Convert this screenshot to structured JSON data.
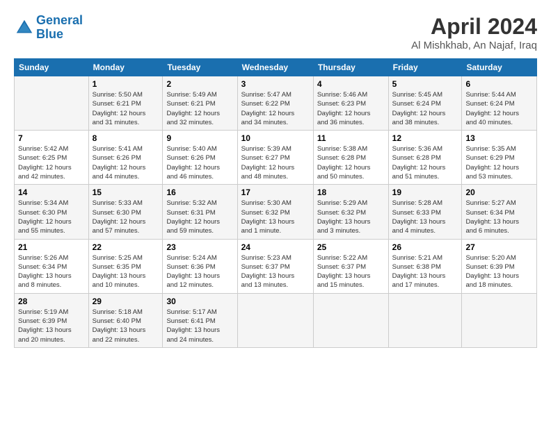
{
  "header": {
    "logo_line1": "General",
    "logo_line2": "Blue",
    "month_title": "April 2024",
    "location": "Al Mishkhab, An Najaf, Iraq"
  },
  "days_of_week": [
    "Sunday",
    "Monday",
    "Tuesday",
    "Wednesday",
    "Thursday",
    "Friday",
    "Saturday"
  ],
  "weeks": [
    [
      {
        "num": "",
        "info": ""
      },
      {
        "num": "1",
        "info": "Sunrise: 5:50 AM\nSunset: 6:21 PM\nDaylight: 12 hours\nand 31 minutes."
      },
      {
        "num": "2",
        "info": "Sunrise: 5:49 AM\nSunset: 6:21 PM\nDaylight: 12 hours\nand 32 minutes."
      },
      {
        "num": "3",
        "info": "Sunrise: 5:47 AM\nSunset: 6:22 PM\nDaylight: 12 hours\nand 34 minutes."
      },
      {
        "num": "4",
        "info": "Sunrise: 5:46 AM\nSunset: 6:23 PM\nDaylight: 12 hours\nand 36 minutes."
      },
      {
        "num": "5",
        "info": "Sunrise: 5:45 AM\nSunset: 6:24 PM\nDaylight: 12 hours\nand 38 minutes."
      },
      {
        "num": "6",
        "info": "Sunrise: 5:44 AM\nSunset: 6:24 PM\nDaylight: 12 hours\nand 40 minutes."
      }
    ],
    [
      {
        "num": "7",
        "info": "Sunrise: 5:42 AM\nSunset: 6:25 PM\nDaylight: 12 hours\nand 42 minutes."
      },
      {
        "num": "8",
        "info": "Sunrise: 5:41 AM\nSunset: 6:26 PM\nDaylight: 12 hours\nand 44 minutes."
      },
      {
        "num": "9",
        "info": "Sunrise: 5:40 AM\nSunset: 6:26 PM\nDaylight: 12 hours\nand 46 minutes."
      },
      {
        "num": "10",
        "info": "Sunrise: 5:39 AM\nSunset: 6:27 PM\nDaylight: 12 hours\nand 48 minutes."
      },
      {
        "num": "11",
        "info": "Sunrise: 5:38 AM\nSunset: 6:28 PM\nDaylight: 12 hours\nand 50 minutes."
      },
      {
        "num": "12",
        "info": "Sunrise: 5:36 AM\nSunset: 6:28 PM\nDaylight: 12 hours\nand 51 minutes."
      },
      {
        "num": "13",
        "info": "Sunrise: 5:35 AM\nSunset: 6:29 PM\nDaylight: 12 hours\nand 53 minutes."
      }
    ],
    [
      {
        "num": "14",
        "info": "Sunrise: 5:34 AM\nSunset: 6:30 PM\nDaylight: 12 hours\nand 55 minutes."
      },
      {
        "num": "15",
        "info": "Sunrise: 5:33 AM\nSunset: 6:30 PM\nDaylight: 12 hours\nand 57 minutes."
      },
      {
        "num": "16",
        "info": "Sunrise: 5:32 AM\nSunset: 6:31 PM\nDaylight: 12 hours\nand 59 minutes."
      },
      {
        "num": "17",
        "info": "Sunrise: 5:30 AM\nSunset: 6:32 PM\nDaylight: 13 hours\nand 1 minute."
      },
      {
        "num": "18",
        "info": "Sunrise: 5:29 AM\nSunset: 6:32 PM\nDaylight: 13 hours\nand 3 minutes."
      },
      {
        "num": "19",
        "info": "Sunrise: 5:28 AM\nSunset: 6:33 PM\nDaylight: 13 hours\nand 4 minutes."
      },
      {
        "num": "20",
        "info": "Sunrise: 5:27 AM\nSunset: 6:34 PM\nDaylight: 13 hours\nand 6 minutes."
      }
    ],
    [
      {
        "num": "21",
        "info": "Sunrise: 5:26 AM\nSunset: 6:34 PM\nDaylight: 13 hours\nand 8 minutes."
      },
      {
        "num": "22",
        "info": "Sunrise: 5:25 AM\nSunset: 6:35 PM\nDaylight: 13 hours\nand 10 minutes."
      },
      {
        "num": "23",
        "info": "Sunrise: 5:24 AM\nSunset: 6:36 PM\nDaylight: 13 hours\nand 12 minutes."
      },
      {
        "num": "24",
        "info": "Sunrise: 5:23 AM\nSunset: 6:37 PM\nDaylight: 13 hours\nand 13 minutes."
      },
      {
        "num": "25",
        "info": "Sunrise: 5:22 AM\nSunset: 6:37 PM\nDaylight: 13 hours\nand 15 minutes."
      },
      {
        "num": "26",
        "info": "Sunrise: 5:21 AM\nSunset: 6:38 PM\nDaylight: 13 hours\nand 17 minutes."
      },
      {
        "num": "27",
        "info": "Sunrise: 5:20 AM\nSunset: 6:39 PM\nDaylight: 13 hours\nand 18 minutes."
      }
    ],
    [
      {
        "num": "28",
        "info": "Sunrise: 5:19 AM\nSunset: 6:39 PM\nDaylight: 13 hours\nand 20 minutes."
      },
      {
        "num": "29",
        "info": "Sunrise: 5:18 AM\nSunset: 6:40 PM\nDaylight: 13 hours\nand 22 minutes."
      },
      {
        "num": "30",
        "info": "Sunrise: 5:17 AM\nSunset: 6:41 PM\nDaylight: 13 hours\nand 24 minutes."
      },
      {
        "num": "",
        "info": ""
      },
      {
        "num": "",
        "info": ""
      },
      {
        "num": "",
        "info": ""
      },
      {
        "num": "",
        "info": ""
      }
    ]
  ]
}
